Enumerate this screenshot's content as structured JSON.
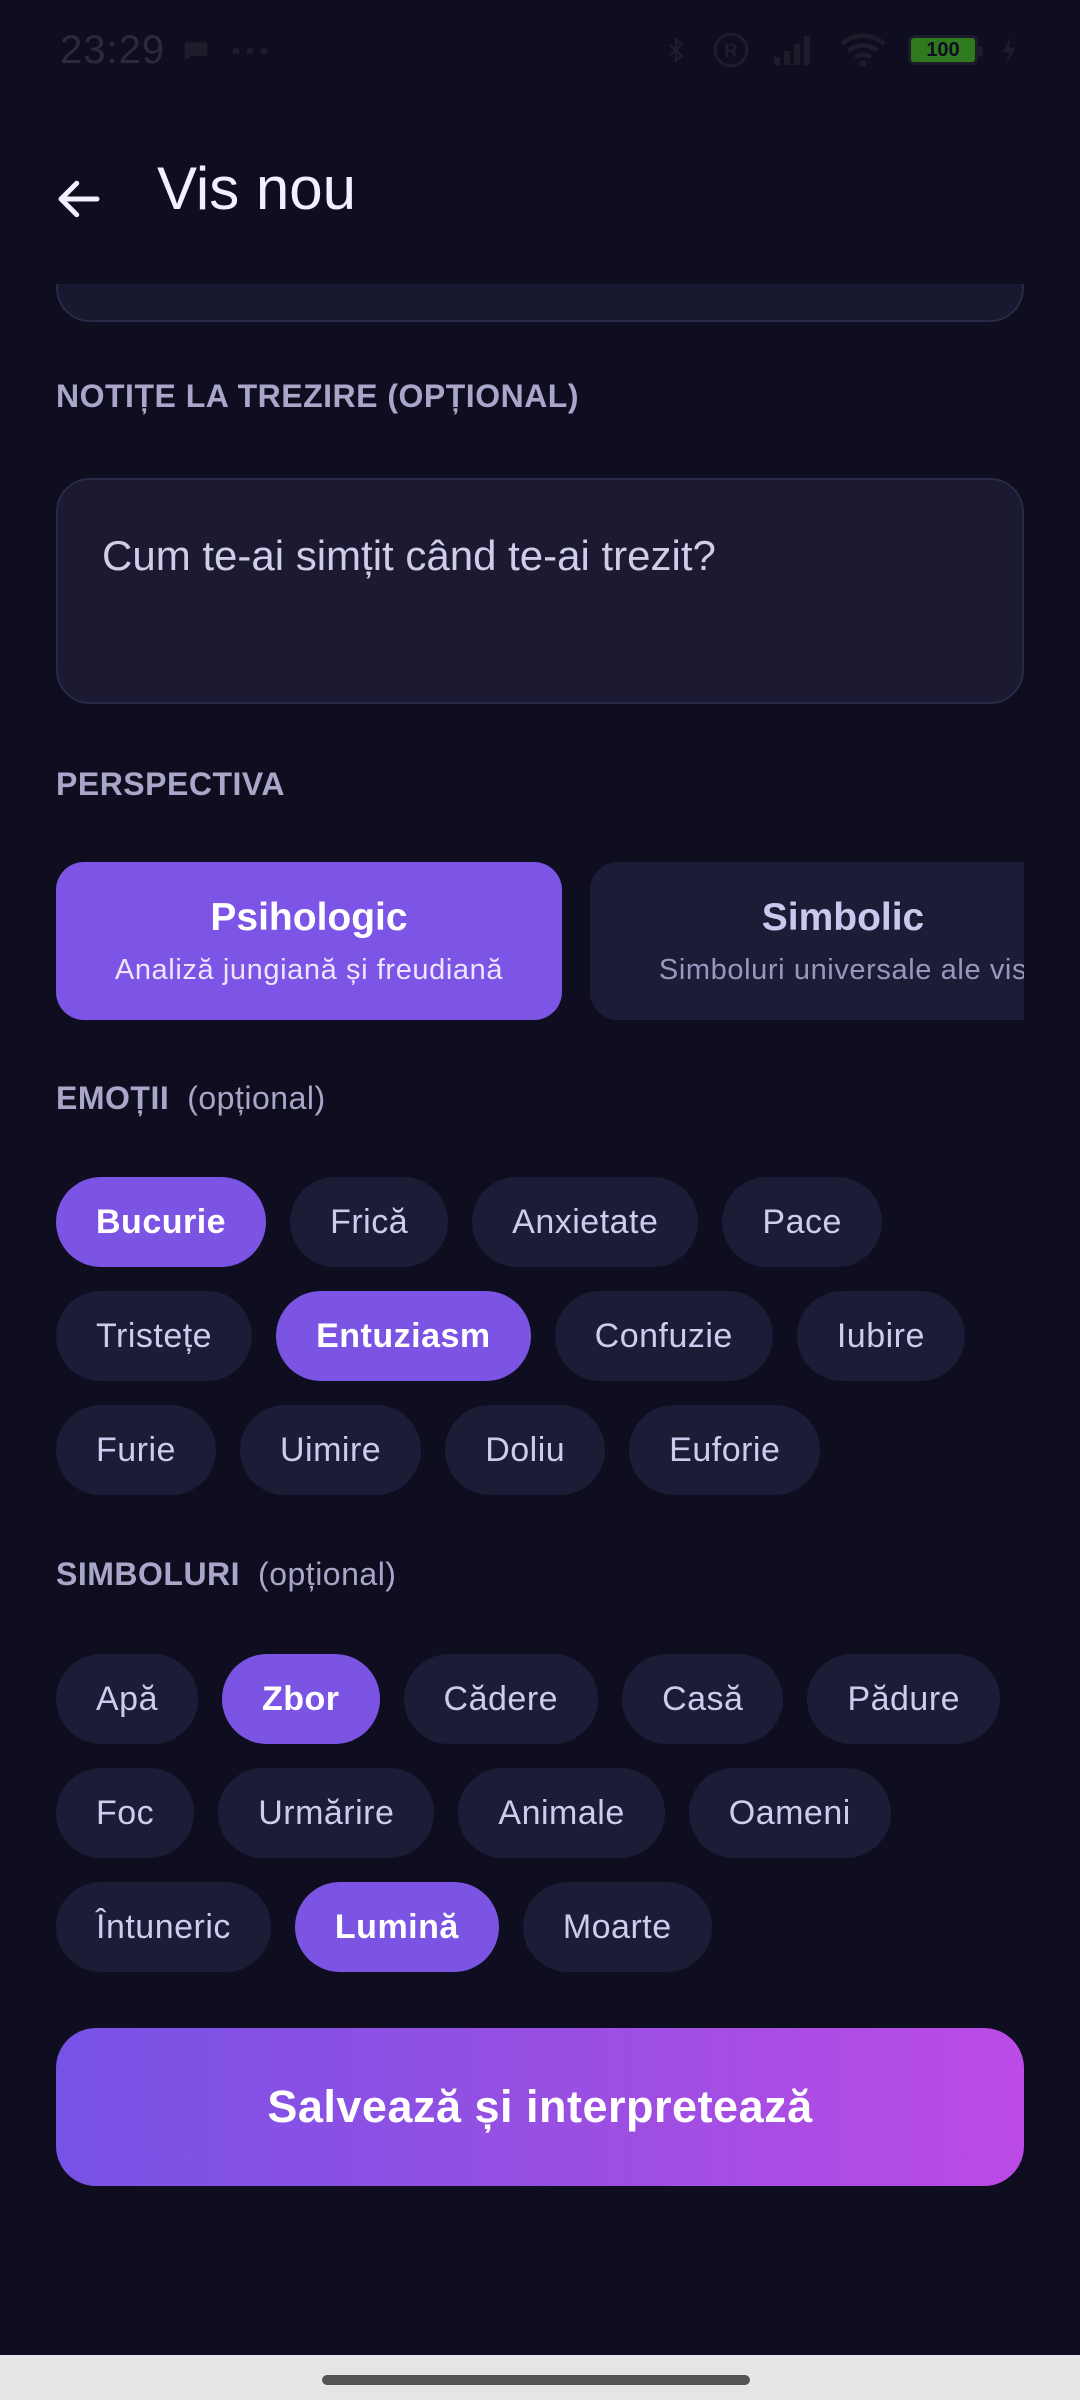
{
  "status_bar": {
    "time": "23:29",
    "left_icons": [
      "message-icon",
      "more-dots-icon"
    ],
    "right_icons": [
      "bluetooth-icon",
      "registered-icon",
      "signal-icon",
      "wifi-icon",
      "battery-icon",
      "charging-icon"
    ],
    "battery": "100"
  },
  "app_bar": {
    "title": "Vis nou",
    "back_icon": "arrow-left-icon"
  },
  "notes": {
    "label": "NOTIȚE LA TREZIRE (OPȚIONAL)",
    "placeholder": "Cum te-ai simțit când te-ai trezit?",
    "value": ""
  },
  "perspective": {
    "label": "PERSPECTIVA",
    "options": [
      {
        "title": "Psihologic",
        "subtitle": "Analiză jungiană și freudiană",
        "selected": true
      },
      {
        "title": "Simbolic",
        "subtitle": "Simboluri universale ale vis",
        "selected": false
      }
    ]
  },
  "emotions": {
    "label": "EMOȚII",
    "optional": "(opțional)",
    "rows": [
      [
        {
          "label": "Bucurie",
          "selected": true
        },
        {
          "label": "Frică",
          "selected": false
        },
        {
          "label": "Anxietate",
          "selected": false
        },
        {
          "label": "Pace",
          "selected": false
        }
      ],
      [
        {
          "label": "Tristețe",
          "selected": false
        },
        {
          "label": "Entuziasm",
          "selected": true
        },
        {
          "label": "Confuzie",
          "selected": false
        },
        {
          "label": "Iubire",
          "selected": false
        }
      ],
      [
        {
          "label": "Furie",
          "selected": false
        },
        {
          "label": "Uimire",
          "selected": false
        },
        {
          "label": "Doliu",
          "selected": false
        },
        {
          "label": "Euforie",
          "selected": false
        }
      ]
    ]
  },
  "symbols": {
    "label": "SIMBOLURI",
    "optional": "(opțional)",
    "rows": [
      [
        {
          "label": "Apă",
          "selected": false
        },
        {
          "label": "Zbor",
          "selected": true
        },
        {
          "label": "Cădere",
          "selected": false
        },
        {
          "label": "Casă",
          "selected": false
        },
        {
          "label": "Pădure",
          "selected": false
        }
      ],
      [
        {
          "label": "Foc",
          "selected": false
        },
        {
          "label": "Urmărire",
          "selected": false
        },
        {
          "label": "Animale",
          "selected": false
        },
        {
          "label": "Oameni",
          "selected": false
        }
      ],
      [
        {
          "label": "Întuneric",
          "selected": false
        },
        {
          "label": "Lumină",
          "selected": true
        },
        {
          "label": "Moarte",
          "selected": false
        }
      ]
    ]
  },
  "submit": {
    "label": "Salvează și interpretează"
  },
  "colors": {
    "background": "#0e0e20",
    "accent": "#7b54e4",
    "chip": "#1d1c36",
    "gradient_end": "#bc4ae6"
  }
}
